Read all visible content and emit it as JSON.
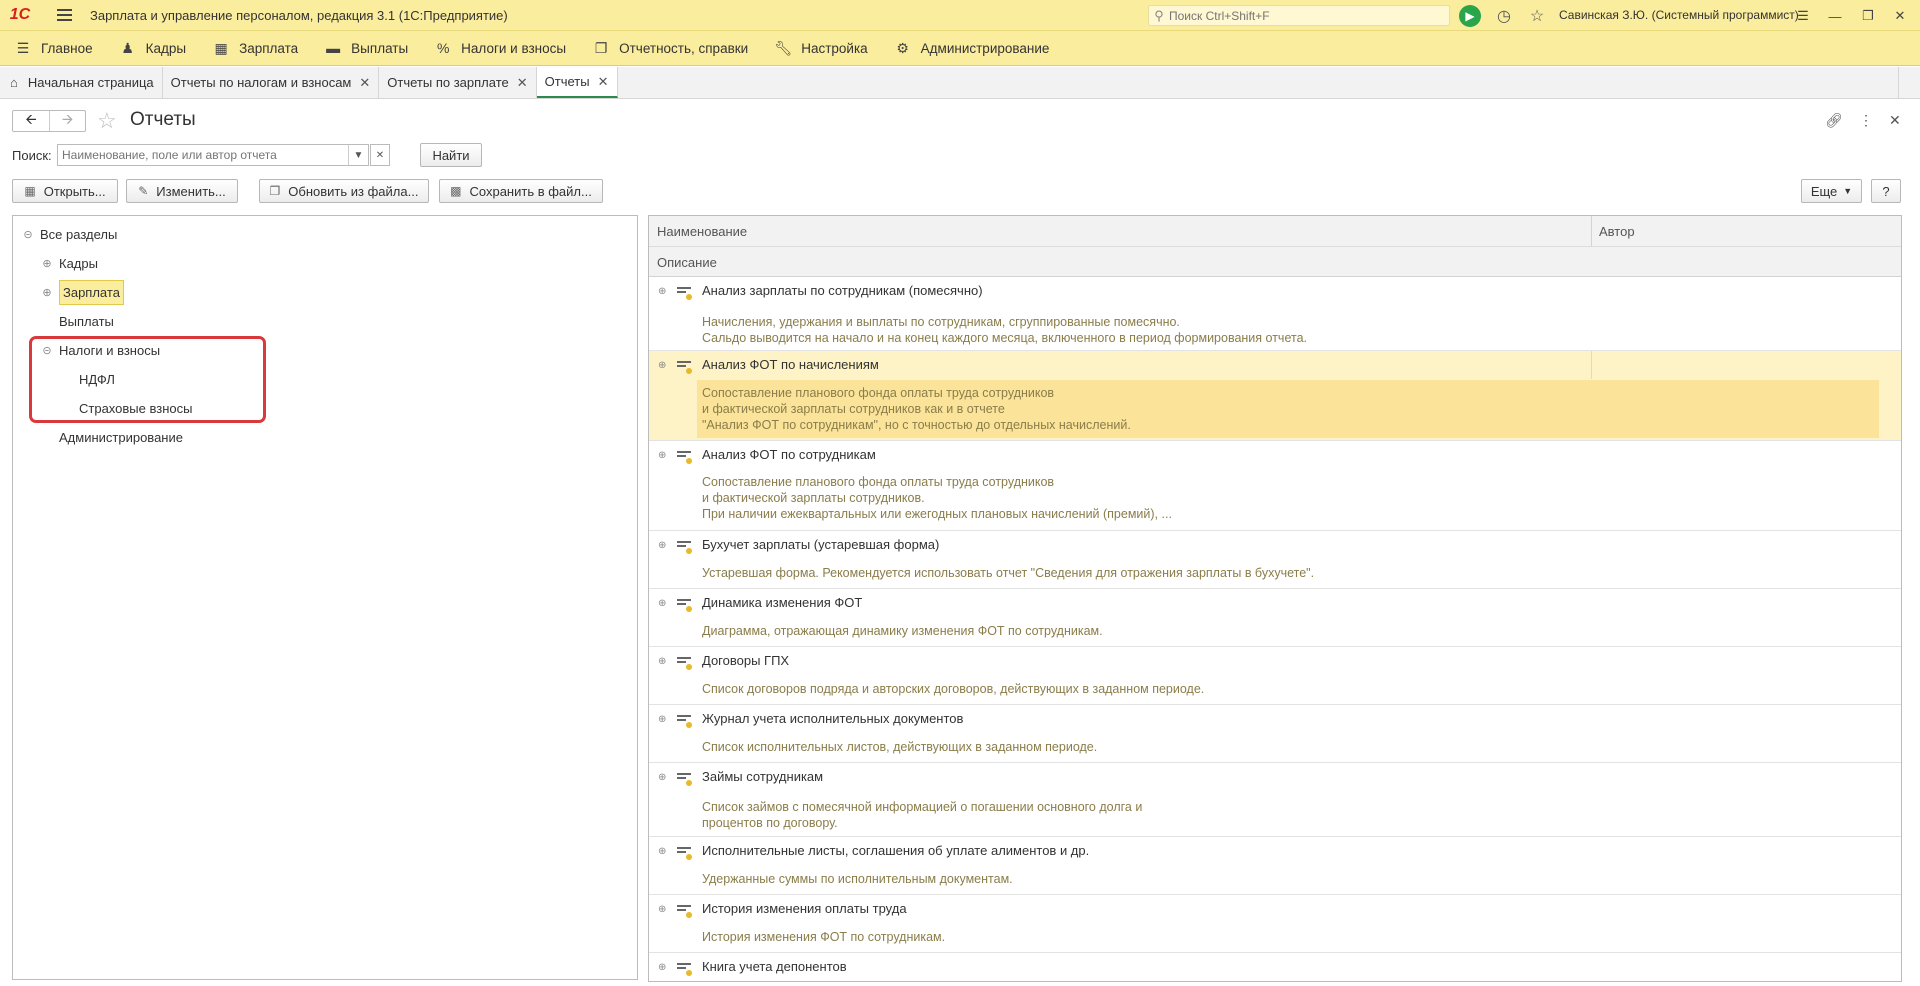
{
  "app": {
    "logo_text": "1С",
    "title": "Зарплата и управление персоналом, редакция 3.1  (1С:Предприятие)",
    "search_placeholder": "Поиск Ctrl+Shift+F",
    "user": "Савинская З.Ю. (Системный программист)"
  },
  "sections": [
    {
      "label": "Главное",
      "icon": "menu-icon"
    },
    {
      "label": "Кадры",
      "icon": "people-icon"
    },
    {
      "label": "Зарплата",
      "icon": "calculator-icon"
    },
    {
      "label": "Выплаты",
      "icon": "wallet-icon"
    },
    {
      "label": "Налоги и взносы",
      "icon": "percent-icon"
    },
    {
      "label": "Отчетность, справки",
      "icon": "documents-icon"
    },
    {
      "label": "Настройка",
      "icon": "wrench-icon"
    },
    {
      "label": "Администрирование",
      "icon": "gear-icon"
    }
  ],
  "tabs": [
    {
      "label": "Начальная страница"
    },
    {
      "label": "Отчеты по налогам и взносам"
    },
    {
      "label": "Отчеты по зарплате"
    },
    {
      "label": "Отчеты"
    }
  ],
  "form": {
    "title": "Отчеты",
    "search_label": "Поиск:",
    "search_placeholder": "Наименование, поле или автор отчета",
    "find_button": "Найти",
    "open_button": "Открыть...",
    "edit_button": "Изменить...",
    "update_button": "Обновить из файла...",
    "save_button": "Сохранить в файл...",
    "more_button": "Еще",
    "help_button": "?"
  },
  "tree": {
    "root": "Все разделы",
    "items": [
      {
        "label": "Кадры"
      },
      {
        "label": "Зарплата"
      },
      {
        "label": "Выплаты"
      },
      {
        "label": "Налоги и взносы"
      },
      {
        "label": "НДФЛ"
      },
      {
        "label": "Страховые взносы"
      },
      {
        "label": "Администрирование"
      }
    ]
  },
  "list": {
    "col_name": "Наименование",
    "col_author": "Автор",
    "col_desc": "Описание",
    "rows": [
      {
        "name": "Анализ зарплаты по сотрудникам (помесячно)",
        "desc": [
          "Начисления, удержания и выплаты по сотрудникам, сгруппированные помесячно.",
          "Сальдо выводится на начало и на конец каждого месяца, включенного в период формирования отчета."
        ]
      },
      {
        "name": "Анализ ФОТ по начислениям",
        "desc": [
          "Сопоставление планового фонда оплаты труда сотрудников",
          "и фактической зарплаты сотрудников как и в отчете",
          "\"Анализ ФОТ по сотрудникам\", но с точностью до отдельных начислений."
        ]
      },
      {
        "name": "Анализ ФОТ по сотрудникам",
        "desc": [
          "Сопоставление планового фонда оплаты труда сотрудников",
          "и фактической зарплаты сотрудников.",
          "При наличии ежеквартальных или ежегодных плановых начислений (премий), ..."
        ]
      },
      {
        "name": "Бухучет зарплаты (устаревшая форма)",
        "desc": [
          "Устаревшая форма. Рекомендуется использовать отчет \"Сведения для отражения зарплаты в бухучете\"."
        ]
      },
      {
        "name": "Динамика изменения ФОТ",
        "desc": [
          "Диаграмма, отражающая динамику изменения ФОТ по сотрудникам."
        ]
      },
      {
        "name": "Договоры ГПХ",
        "desc": [
          "Список договоров подряда и авторских договоров, действующих в заданном периоде."
        ]
      },
      {
        "name": "Журнал учета исполнительных документов",
        "desc": [
          "Список исполнительных листов, действующих в заданном периоде."
        ]
      },
      {
        "name": "Займы сотрудникам",
        "desc": [
          "Список займов с помесячной информацией о погашении основного долга и",
          "процентов по договору."
        ]
      },
      {
        "name": "Исполнительные листы, соглашения об уплате алиментов и др.",
        "desc": [
          "Удержанные суммы по исполнительным документам."
        ]
      },
      {
        "name": "История изменения оплаты труда",
        "desc": [
          "История изменения ФОТ по сотрудникам."
        ]
      },
      {
        "name": "Книга учета депонентов",
        "desc": []
      }
    ]
  }
}
